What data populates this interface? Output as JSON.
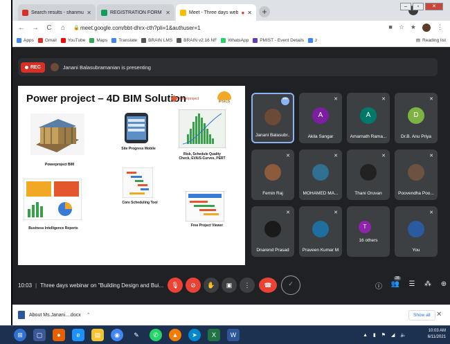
{
  "browser": {
    "tabs": [
      {
        "label": "Search results - shanmugavelu",
        "icon": "gmail-icon",
        "color": "#d93025"
      },
      {
        "label": "REGISTRATION FORM (Respons",
        "icon": "forms-icon",
        "color": "#0f9d58"
      },
      {
        "label": "Meet - Three days webinar",
        "icon": "meet-icon",
        "color": "#fbbc04"
      }
    ],
    "url": "meet.google.com/bbt-dhrx-cth?pli=1&authuser=1",
    "bookmarks": [
      {
        "label": "Apps",
        "color": "#4285f4"
      },
      {
        "label": "Gmail",
        "color": "#d93025"
      },
      {
        "label": "YouTube",
        "color": "#ff0000"
      },
      {
        "label": "Maps",
        "color": "#34a853"
      },
      {
        "label": "Translate",
        "color": "#4285f4"
      },
      {
        "label": "BRAIN LMS",
        "color": "#555555"
      },
      {
        "label": "BRAIN v2.16 NF",
        "color": "#555555"
      },
      {
        "label": "WhatsApp",
        "color": "#25d366"
      },
      {
        "label": "PMIST - Event Details",
        "color": "#673ab7"
      },
      {
        "label": "z",
        "color": "#4285f4"
      }
    ],
    "reading_list": "Reading list"
  },
  "meet": {
    "rec_label": "REC",
    "presenting_text": "Janani Balasubramanian is presenting",
    "slide": {
      "title": "Power project – 4D BIM Solution",
      "logo_pp": "Powerproject",
      "logo_ip": "IPSICS",
      "items": [
        "Powerproject BIM",
        "Site Progress Mobile",
        "Risk, Schedule Quality Check, EVA/S-Curves, PERT",
        "Core Scheduling Tool",
        "Business Intelligence Reports",
        "Free Project Viewer"
      ]
    },
    "participants": [
      {
        "name": "Janani Balasubr...",
        "initial": "",
        "color": "#6b4a37"
      },
      {
        "name": "Akila Sangar",
        "initial": "A",
        "color": "#7b1fa2"
      },
      {
        "name": "Amarnath Rama...",
        "initial": "A",
        "color": "#00796b"
      },
      {
        "name": "Dr.B. Anu Priya",
        "initial": "D",
        "color": "#7cb342"
      },
      {
        "name": "Femin Raj",
        "initial": "",
        "color": "#8d5a3b"
      },
      {
        "name": "MOHAMED MA...",
        "initial": "",
        "color": "#2f6f8f"
      },
      {
        "name": "Thani Oruvan",
        "initial": "",
        "color": "#222222"
      },
      {
        "name": "Poovendha Poo...",
        "initial": "",
        "color": "#6d5240"
      },
      {
        "name": "Dnarend Prasad",
        "initial": "",
        "color": "#1a1a1a"
      },
      {
        "name": "Praveen Kumar M",
        "initial": "",
        "color": "#1e6f9f"
      },
      {
        "name": "16 others",
        "initial": "T",
        "color": "#8e24aa"
      },
      {
        "name": "You",
        "initial": "",
        "color": "#2c5aa0"
      }
    ],
    "time": "10:03",
    "meeting_title": "Three days webinar on \"Building Design and Bui...",
    "people_count": "28"
  },
  "download": {
    "filename": "About Ms.Janani....docx",
    "show_all": "Show all"
  },
  "taskbar": {
    "clock_time": "10:03 AM",
    "clock_date": "6/11/2021"
  }
}
